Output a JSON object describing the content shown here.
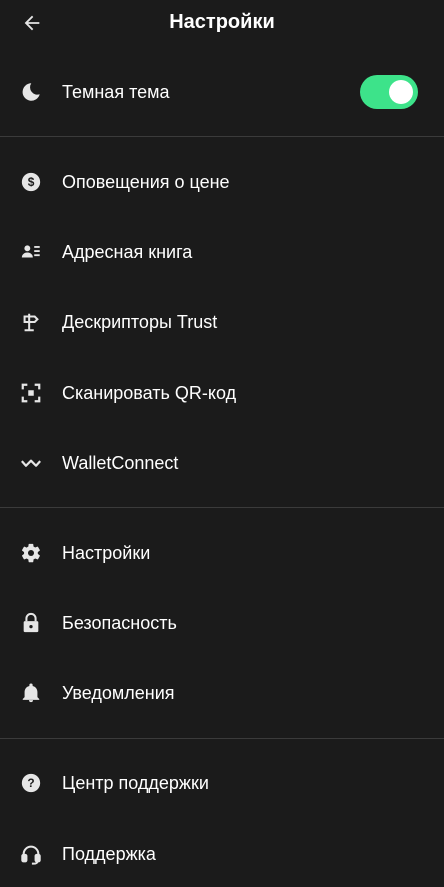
{
  "header": {
    "title": "Настройки",
    "back_icon": "arrow-left-icon"
  },
  "theme": {
    "colors": {
      "background": "#1b1b1b",
      "divider": "#3b3b3b",
      "toggle_on": "#3de38a",
      "text": "#ffffff",
      "icon": "#e6e6e6"
    }
  },
  "dark_mode": {
    "label": "Темная тема",
    "icon": "moon-icon",
    "enabled": true
  },
  "menu": {
    "group1": [
      {
        "label": "Оповещения о цене",
        "icon": "dollar-circle-icon"
      },
      {
        "label": "Адресная книга",
        "icon": "contacts-book-icon"
      },
      {
        "label": "Дескрипторы Trust",
        "icon": "signpost-icon"
      },
      {
        "label": "Сканировать QR-код",
        "icon": "qr-scan-icon"
      },
      {
        "label": "WalletConnect",
        "icon": "walletconnect-icon"
      }
    ],
    "group2": [
      {
        "label": "Настройки",
        "icon": "gear-icon"
      },
      {
        "label": "Безопасность",
        "icon": "lock-icon"
      },
      {
        "label": "Уведомления",
        "icon": "bell-icon"
      }
    ],
    "group3": [
      {
        "label": "Центр поддержки",
        "icon": "question-circle-icon"
      },
      {
        "label": "Поддержка",
        "icon": "headset-icon"
      }
    ]
  }
}
